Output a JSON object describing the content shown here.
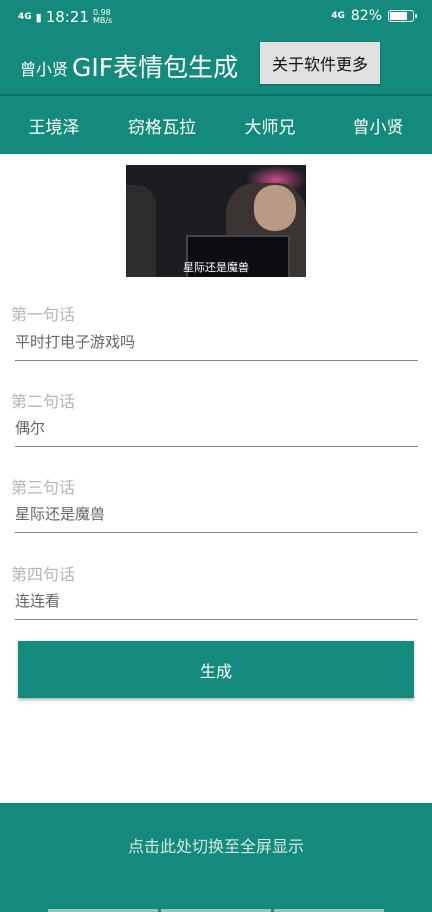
{
  "status_bar": {
    "network_left": "4G",
    "time": "18:21",
    "speed_value": "0.98",
    "speed_unit": "MB/s",
    "network_right": "4G",
    "battery_percent": "82%",
    "battery_level": 0.82
  },
  "app_bar": {
    "user": "曾小贤",
    "title": "GIF表情包生成",
    "about_label": "关于软件更多"
  },
  "tabs": [
    {
      "label": "王境泽"
    },
    {
      "label": "窃格瓦拉"
    },
    {
      "label": "大师兄"
    },
    {
      "label": "曾小贤"
    }
  ],
  "preview": {
    "caption": "星际还是魔兽"
  },
  "fields": [
    {
      "label": "第一句话",
      "value": "平时打电子游戏吗"
    },
    {
      "label": "第二句话",
      "value": "偶尔"
    },
    {
      "label": "第三句话",
      "value": "星际还是魔兽"
    },
    {
      "label": "第四句话",
      "value": "连连看"
    }
  ],
  "generate_label": "生成",
  "footer": {
    "fullscreen_label": "点击此处切换至全屏显示"
  },
  "colors": {
    "primary": "#148a7c",
    "button_grey": "#e0e0e0"
  }
}
